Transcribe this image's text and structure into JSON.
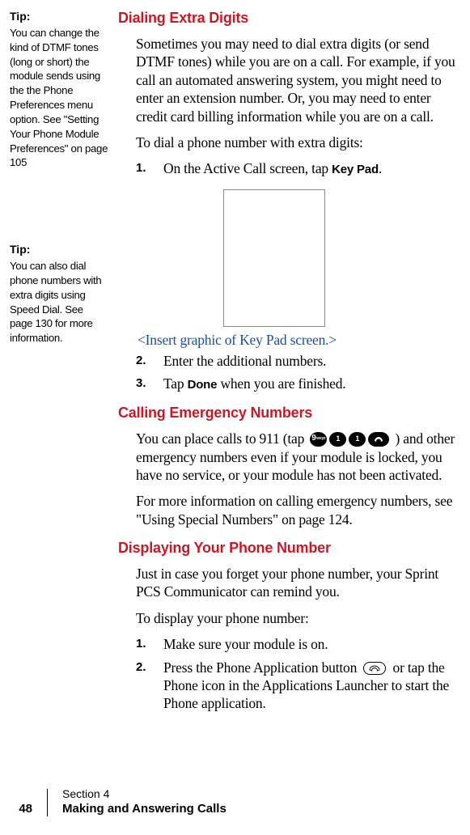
{
  "sidebar": {
    "tip1": {
      "head": "Tip:",
      "body": "You can change the kind of DTMF tones (long or short) the module sends using the the Phone Preferences menu option. See \"Setting Your Phone Module Preferences\" on page 105"
    },
    "tip2": {
      "head": "Tip:",
      "body": "You can also dial phone numbers with extra digits using Speed Dial. See page 130 for more information."
    }
  },
  "main": {
    "h1": "Dialing Extra Digits",
    "p1a": "Sometimes you may need to dial extra digits (or send DTMF tones) while you are on a call. For example, if you call an automated answering system, you might need to enter an extension number. Or, you may need to enter credit card billing information while you are on a call.",
    "p1b": "To dial a phone number with extra digits:",
    "step1_num": "1.",
    "step1_pre": "On the Active Call screen, tap ",
    "step1_bold": "Key Pad",
    "step1_post": ".",
    "insert": "<Insert graphic of Key Pad screen.>",
    "step2_num": "2.",
    "step2_text": "Enter the additional numbers.",
    "step3_num": "3.",
    "step3_pre": "Tap ",
    "step3_bold": "Done",
    "step3_post": " when you are finished.",
    "h2": "Calling Emergency Numbers",
    "p2a_pre": "You can place calls to 911 (tap ",
    "p2a_post": " ) and other emergency numbers even if your module is locked, you have no service, or your module has not been activated.",
    "p2b": "For more information on calling emergency numbers, see \"Using Special Numbers\" on page 124.",
    "h3": "Displaying Your Phone Number",
    "p3a": "Just in case you forget your phone number, your Sprint PCS Communicator can remind you.",
    "p3b": "To display your phone number:",
    "step4_num": "1.",
    "step4_text": "Make sure your module is on.",
    "step5_num": "2.",
    "step5_pre": "Press the Phone Application button ",
    "step5_post": " or tap the Phone icon in the Applications Launcher to start the Phone application.",
    "icons": {
      "key9_main": "9",
      "key9_sub": "wxyz",
      "key1": "1",
      "key1b": "1"
    }
  },
  "footer": {
    "page": "48",
    "section": "Section 4",
    "title": "Making and Answering Calls"
  }
}
